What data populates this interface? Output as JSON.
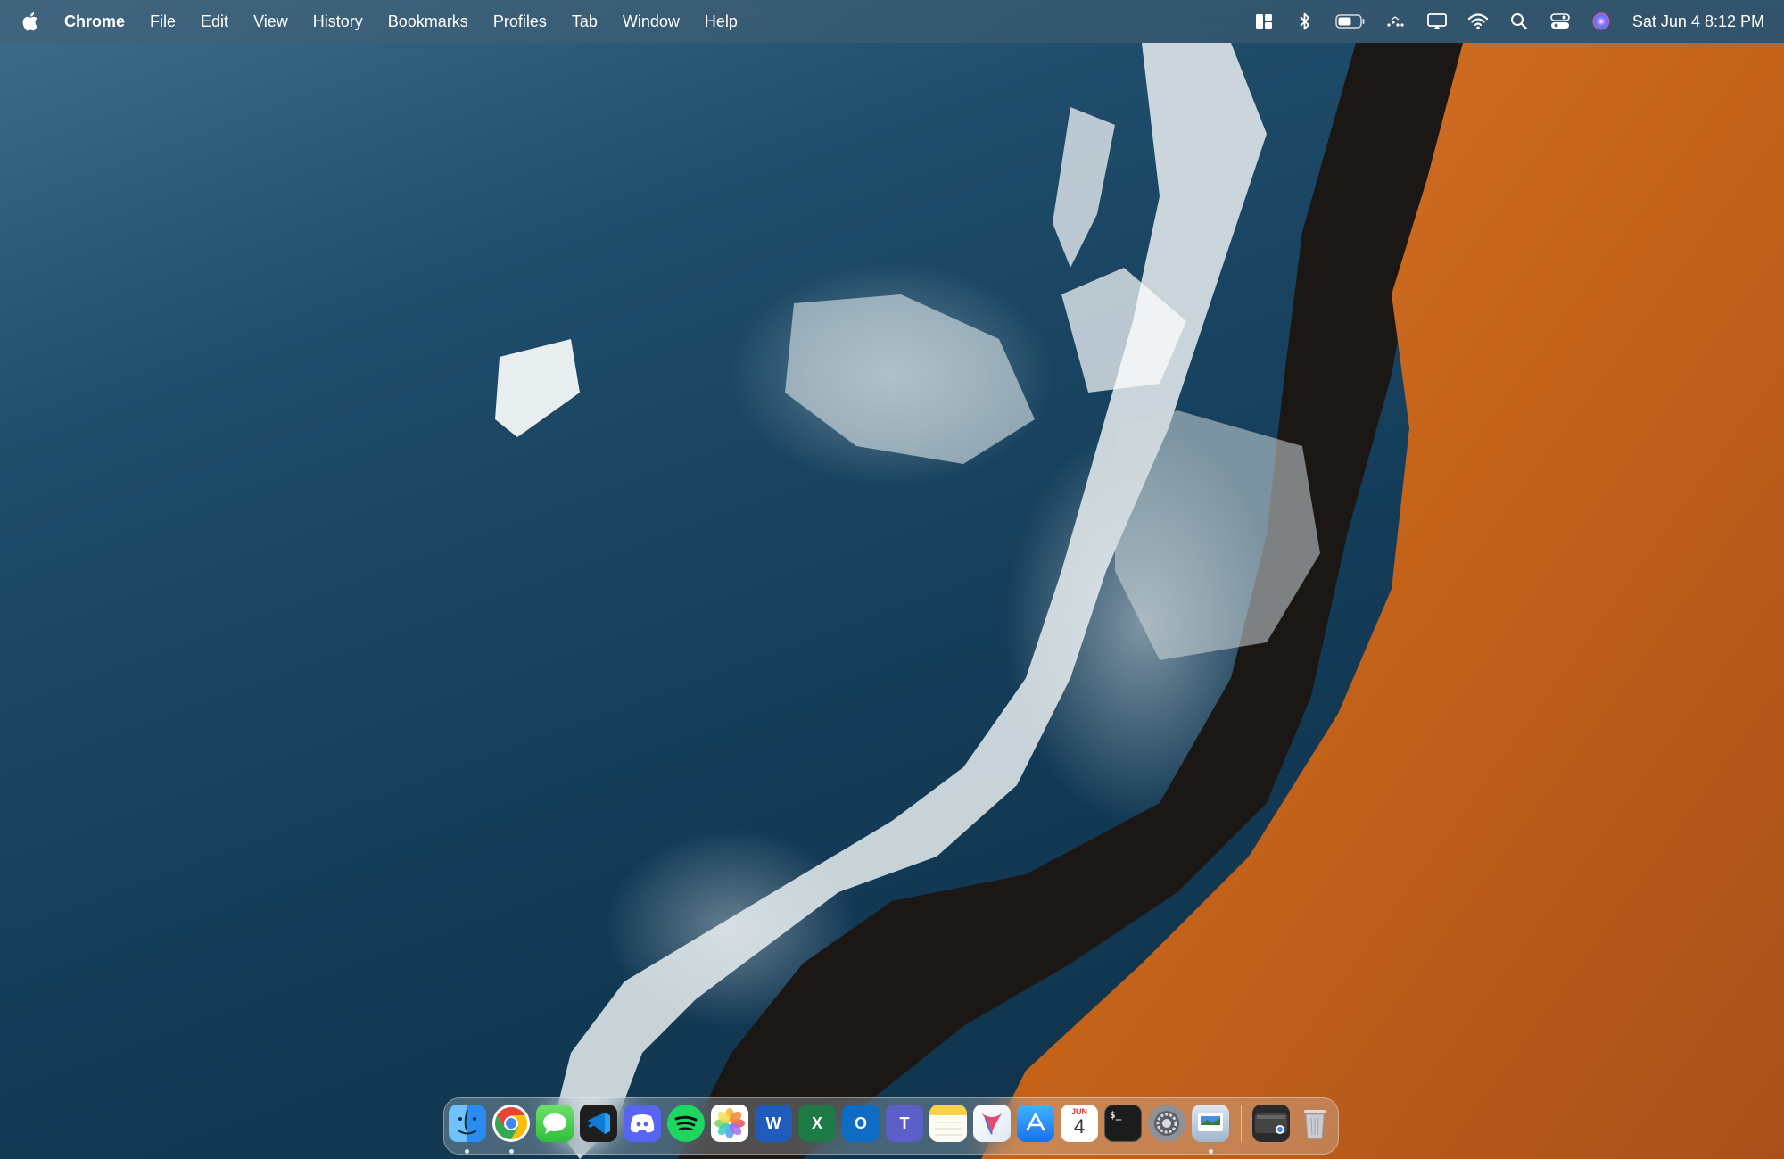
{
  "menubar": {
    "app_name": "Chrome",
    "menus": [
      "File",
      "Edit",
      "View",
      "History",
      "Bookmarks",
      "Profiles",
      "Tab",
      "Window",
      "Help"
    ],
    "clock": "Sat Jun 4  8:12 PM",
    "status_icons": [
      "window-layout-icon",
      "bluetooth-icon",
      "battery-icon",
      "dots-icon",
      "screen-mirroring-icon",
      "wifi-icon",
      "search-icon",
      "control-center-icon",
      "siri-icon"
    ]
  },
  "dock": {
    "apps": [
      {
        "name": "Finder",
        "icon": "finder-icon"
      },
      {
        "name": "Google Chrome",
        "icon": "chrome-icon"
      },
      {
        "name": "Messages",
        "icon": "messages-icon"
      },
      {
        "name": "Visual Studio Code",
        "icon": "vscode-icon"
      },
      {
        "name": "Discord",
        "icon": "discord-icon"
      },
      {
        "name": "Spotify",
        "icon": "spotify-icon"
      },
      {
        "name": "Photos",
        "icon": "photos-icon"
      },
      {
        "name": "Microsoft Word",
        "icon": "word-icon",
        "letter": "W"
      },
      {
        "name": "Microsoft Excel",
        "icon": "excel-icon",
        "letter": "X"
      },
      {
        "name": "Microsoft Outlook",
        "icon": "outlook-icon",
        "letter": "O"
      },
      {
        "name": "Microsoft Teams",
        "icon": "teams-icon",
        "letter": "T"
      },
      {
        "name": "Notes",
        "icon": "notes-icon"
      },
      {
        "name": "Cursor",
        "icon": "cursor-app-icon"
      },
      {
        "name": "App Store",
        "icon": "app-store-icon"
      },
      {
        "name": "Calendar",
        "icon": "calendar-icon",
        "month": "JUN",
        "day": "4"
      },
      {
        "name": "Terminal",
        "icon": "terminal-icon",
        "prompt": "$_"
      },
      {
        "name": "System Settings",
        "icon": "settings-icon"
      },
      {
        "name": "Preview",
        "icon": "preview-icon"
      },
      {
        "name": "Chrome Apps",
        "icon": "chrome-apps-folder-icon"
      },
      {
        "name": "Trash",
        "icon": "trash-icon"
      }
    ]
  },
  "colors": {
    "ocean": "#1f4d6b",
    "cliff": "#c4621a",
    "menubar": "#4f6d82"
  }
}
